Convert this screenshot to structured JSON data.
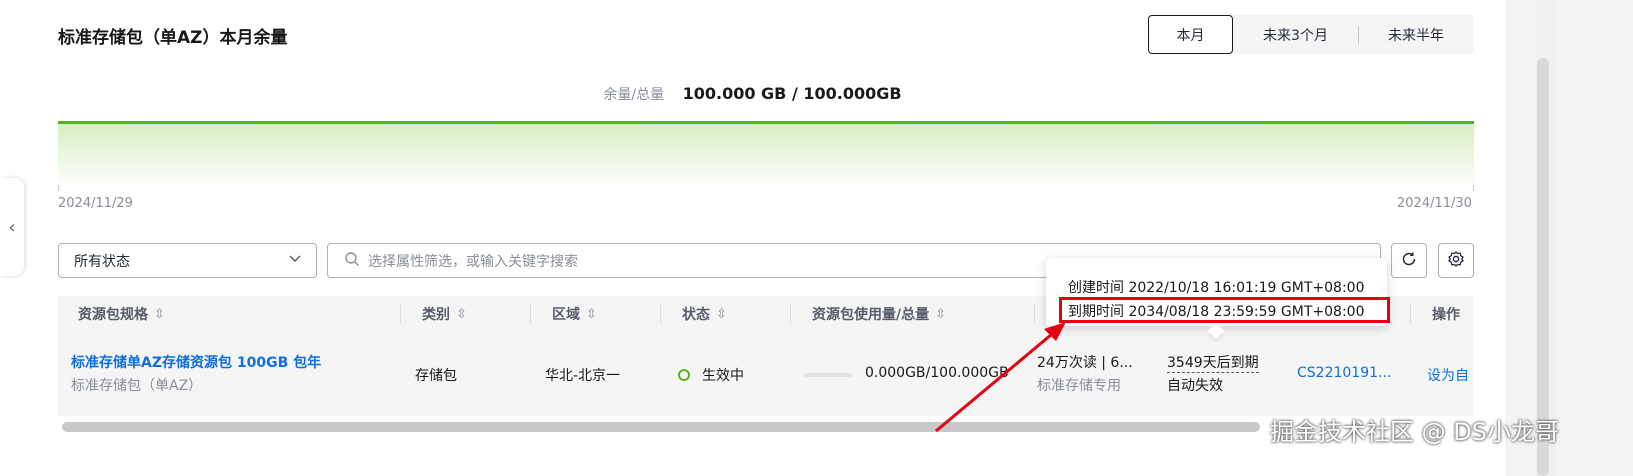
{
  "panel": {
    "title": "标准存储包（单AZ）本月余量"
  },
  "period_tabs": [
    {
      "label": "本月",
      "active": true
    },
    {
      "label": "未来3个月",
      "active": false
    },
    {
      "label": "未来半年",
      "active": false
    }
  ],
  "usage": {
    "label": "余量/总量",
    "value": "100.000 GB / 100.000GB"
  },
  "chart_data": {
    "type": "area",
    "x": [
      "2024/11/29",
      "2024/11/30"
    ],
    "values": [
      100.0,
      100.0
    ],
    "xlabel": "",
    "ylabel": "",
    "colors": {
      "line": "#5cb318",
      "fill": "#e6f4d8"
    }
  },
  "filters": {
    "status_selected": "所有状态",
    "search_placeholder": "选择属性筛选，或输入关键字搜索"
  },
  "table": {
    "columns": [
      "资源包规格",
      "类别",
      "区域",
      "状态",
      "资源包使用量/总量",
      "操作"
    ],
    "rows": [
      {
        "name": "标准存储单AZ存储资源包 100GB 包年",
        "sub": "标准存储包（单AZ）",
        "category": "存储包",
        "region": "华北-北京一",
        "status": "生效中",
        "usage": "0.000GB/100.000GB",
        "quota": "24万次读 | 6...",
        "quota_sub": "标准存储专用",
        "expire": "3549天后到期",
        "expire_sub": "自动失效",
        "order_id": "CS2210191...",
        "action": "设为自"
      }
    ]
  },
  "tooltip": {
    "created": "创建时间 2022/10/18 16:01:19 GMT+08:00",
    "expires": "到期时间 2034/08/18 23:59:59 GMT+08:00"
  },
  "watermark": "掘金技术社区 @ DS小龙哥",
  "colors": {
    "accent": "#5cb318",
    "link": "#0d6fdf",
    "highlight": "#e60012"
  }
}
